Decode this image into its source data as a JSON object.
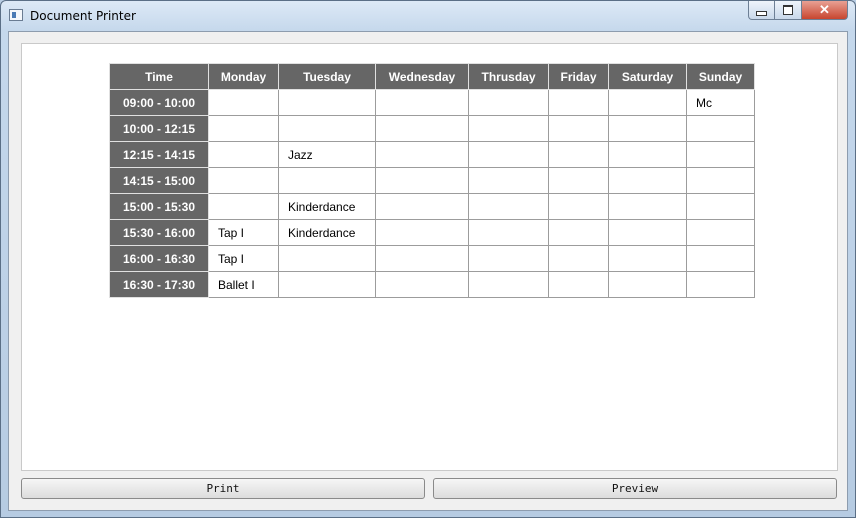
{
  "window": {
    "title": "Document Printer"
  },
  "schedule": {
    "headers": [
      "Time",
      "Monday",
      "Tuesday",
      "Wednesday",
      "Thrusday",
      "Friday",
      "Saturday",
      "Sunday"
    ],
    "rows": [
      {
        "time": "09:00 - 10:00",
        "cells": [
          "",
          "",
          "",
          "",
          "",
          "",
          "Mc"
        ]
      },
      {
        "time": "10:00 - 12:15",
        "cells": [
          "",
          "",
          "",
          "",
          "",
          "",
          ""
        ]
      },
      {
        "time": "12:15 - 14:15",
        "cells": [
          "",
          "Jazz",
          "",
          "",
          "",
          "",
          ""
        ]
      },
      {
        "time": "14:15 - 15:00",
        "cells": [
          "",
          "",
          "",
          "",
          "",
          "",
          ""
        ]
      },
      {
        "time": "15:00 - 15:30",
        "cells": [
          "",
          "Kinderdance",
          "",
          "",
          "",
          "",
          ""
        ]
      },
      {
        "time": "15:30 - 16:00",
        "cells": [
          "Tap I",
          "Kinderdance",
          "",
          "",
          "",
          "",
          ""
        ]
      },
      {
        "time": "16:00 - 16:30",
        "cells": [
          "Tap I",
          "",
          "",
          "",
          "",
          "",
          ""
        ]
      },
      {
        "time": "16:30 - 17:30",
        "cells": [
          "Ballet I",
          "",
          "",
          "",
          "",
          "",
          ""
        ]
      }
    ]
  },
  "buttons": {
    "print": "Print",
    "preview": "Preview"
  },
  "colors": {
    "header_bg": "#666666",
    "header_text": "#ffffff"
  }
}
